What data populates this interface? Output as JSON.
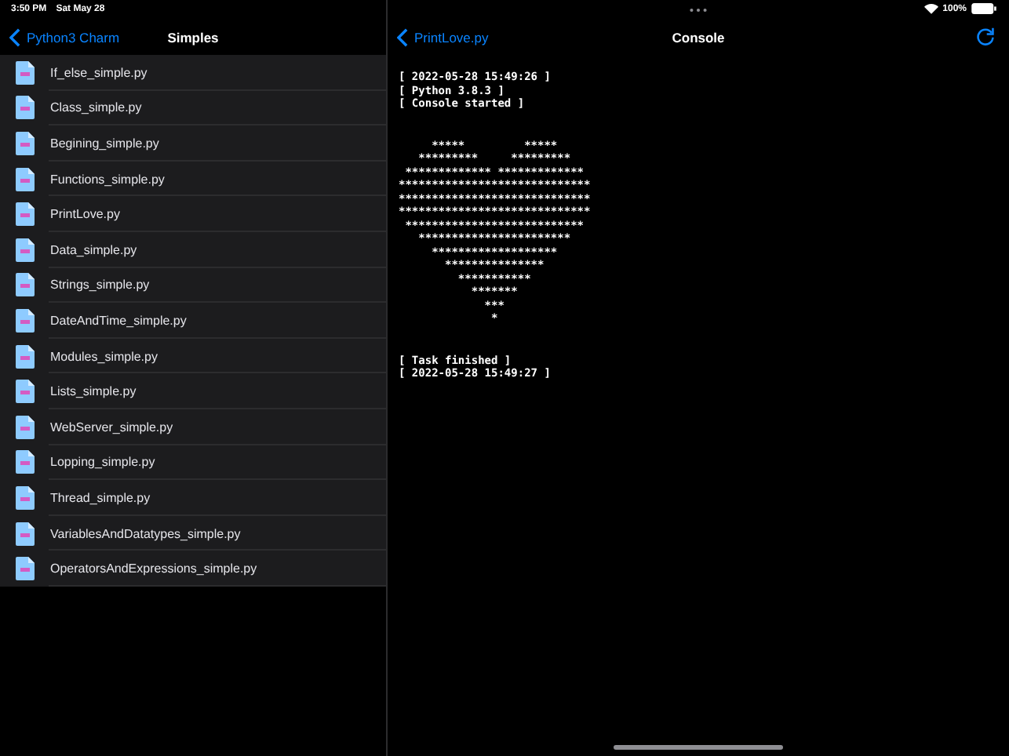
{
  "status_bar": {
    "time": "3:50 PM",
    "date": "Sat May 28",
    "battery": "100%"
  },
  "sidebar": {
    "back_label": "Python3 Charm",
    "title": "Simples",
    "files": [
      {
        "name": "If_else_simple.py"
      },
      {
        "name": "Class_simple.py"
      },
      {
        "name": "Begining_simple.py"
      },
      {
        "name": "Functions_simple.py"
      },
      {
        "name": "PrintLove.py"
      },
      {
        "name": "Data_simple.py"
      },
      {
        "name": "Strings_simple.py"
      },
      {
        "name": "DateAndTime_simple.py"
      },
      {
        "name": "Modules_simple.py"
      },
      {
        "name": "Lists_simple.py"
      },
      {
        "name": "WebServer_simple.py"
      },
      {
        "name": "Lopping_simple.py"
      },
      {
        "name": "Thread_simple.py"
      },
      {
        "name": "VariablesAndDatatypes_simple.py"
      },
      {
        "name": "OperatorsAndExpressions_simple.py"
      }
    ]
  },
  "console": {
    "back_label": "PrintLove.py",
    "title": "Console",
    "header_lines": [
      "[ 2022-05-28 15:49:26 ]",
      "[ Python 3.8.3 ]",
      "[ Console started ]"
    ],
    "heart_art": "     *****         *****\n   *********     *********\n ************* *************\n*****************************\n*****************************\n*****************************\n ***************************\n   ***********************\n     *******************\n       ***************\n         ***********\n           *******\n             ***\n              *",
    "footer_lines": [
      "[ Task finished ]",
      "[ 2022-05-28 15:49:27 ]"
    ]
  }
}
